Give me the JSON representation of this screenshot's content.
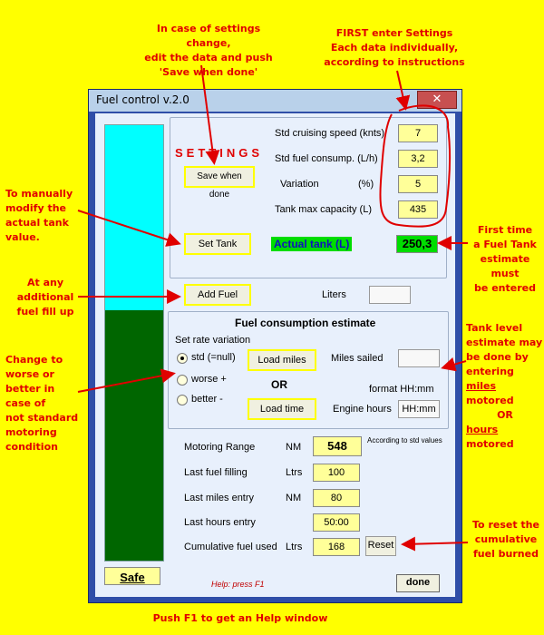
{
  "notes": {
    "settings_change": [
      "In case of settings change,",
      "edit the data and push",
      "'Save when done'"
    ],
    "first_enter": [
      "FIRST enter Settings",
      "Each data individually,",
      "according to instructions"
    ],
    "manual_modify": [
      "To manually",
      "modify the",
      "actual tank",
      "value."
    ],
    "first_time": [
      "First time",
      "a Fuel Tank",
      "estimate must",
      "be entered"
    ],
    "additional_fill": [
      "At any",
      "additional",
      "fuel fill up"
    ],
    "change_worse": [
      "Change to",
      "worse or",
      "better in",
      "case of",
      "not standard",
      "motoring",
      "condition"
    ],
    "tank_level_a": [
      "Tank level",
      "estimate may",
      "be done by",
      "entering"
    ],
    "tank_level_miles": "miles",
    "tank_level_motored1": " motored",
    "tank_level_or": "OR",
    "tank_level_hours": "hours",
    "tank_level_motored2": " motored",
    "reset_note": [
      "To reset the",
      "cumulative",
      "fuel burned"
    ],
    "push_f1": "Push F1 to get an Help window"
  },
  "window": {
    "title": "Fuel control   v.2.0",
    "close_glyph": "✕"
  },
  "settings": {
    "heading": "SETTINGS",
    "save_label": "Save when done",
    "cruise_label": "Std cruising speed (knts)",
    "cruise_value": "7",
    "consump_label": "Std fuel consump. (L/h)",
    "consump_value": "3,2",
    "variation_label": "Variation",
    "variation_unit": "(%)",
    "variation_value": "5",
    "tank_max_label": "Tank max capacity (L)",
    "tank_max_value": "435"
  },
  "tank": {
    "set_tank_label": "Set Tank",
    "actual_label": "Actual  tank  (L)",
    "actual_value": "250,3",
    "level_fraction": 0.575
  },
  "add_fuel": {
    "button_label": "Add Fuel",
    "liters_label": "Liters",
    "liters_value": ""
  },
  "estimate": {
    "title": "Fuel consumption estimate",
    "rate_label": "Set rate variation",
    "std_label": "std   (=null)",
    "worse_label": "worse +",
    "better_label": "better  -",
    "load_miles_label": "Load miles",
    "or_label": "OR",
    "load_time_label": "Load time",
    "miles_sailed_label": "Miles sailed",
    "miles_sailed_value": "",
    "format_label": "format HH:mm",
    "engine_hours_label": "Engine hours",
    "engine_hours_value": "HH:mm"
  },
  "stats": {
    "range_label": "Motoring Range",
    "range_unit": "NM",
    "range_value": "548",
    "range_note": "According to std values",
    "last_fill_label": "Last fuel filling",
    "last_fill_unit": "Ltrs",
    "last_fill_value": "100",
    "last_miles_label": "Last miles entry",
    "last_miles_unit": "NM",
    "last_miles_value": "80",
    "last_hours_label": "Last hours entry",
    "last_hours_value": "50:00",
    "cumulative_label": "Cumulative fuel used",
    "cumulative_unit": "Ltrs",
    "cumulative_value": "168",
    "reset_label": "Reset"
  },
  "footer": {
    "safe_label": "Safe",
    "help_text": "Help: press F1",
    "done_label": "done"
  },
  "colors": {
    "annotation_red": "#e00000",
    "tank_empty": "#00ffff",
    "tank_fuel": "#006600",
    "actual_green": "#00dd00"
  }
}
